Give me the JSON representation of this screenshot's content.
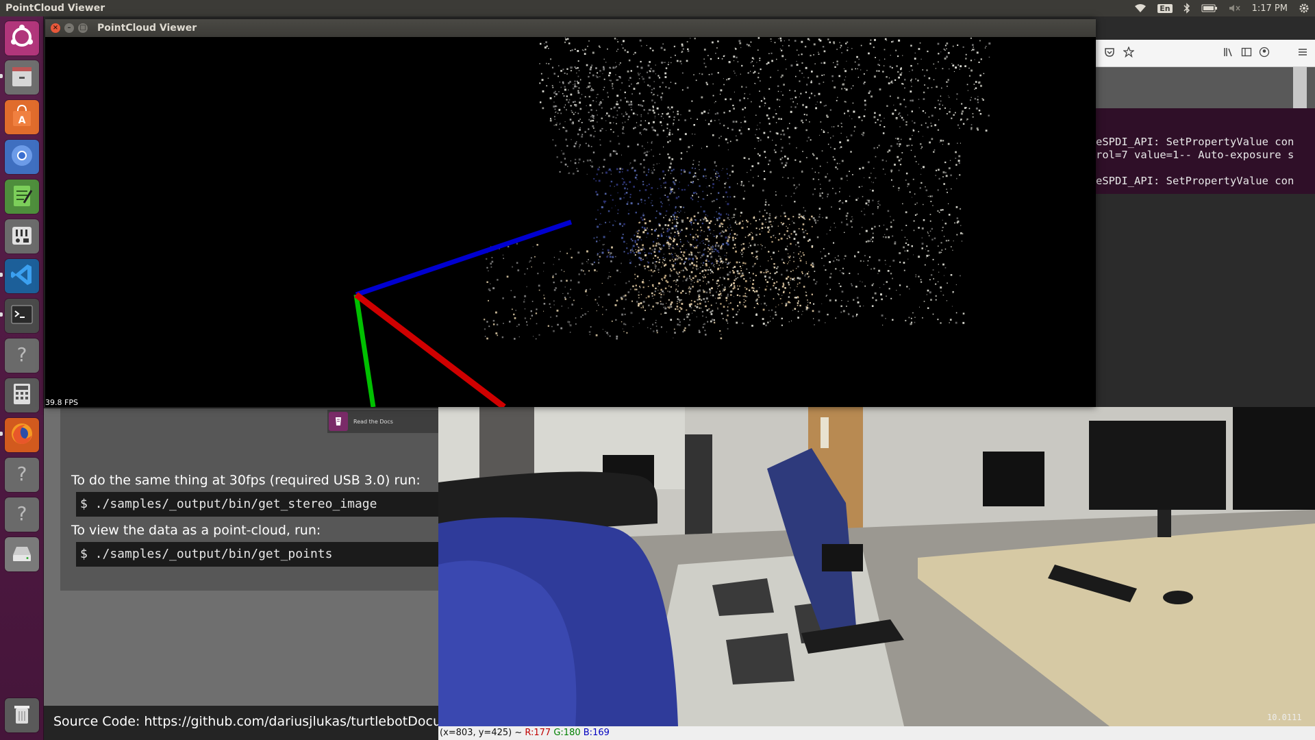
{
  "top_panel": {
    "app_title": "PointCloud Viewer",
    "keyboard_layout": "En",
    "clock": "1:17 PM"
  },
  "launcher": {
    "items": [
      {
        "name": "ubuntu-dash",
        "icon": "ubuntu-logo-icon"
      },
      {
        "name": "files",
        "icon": "file-cabinet-icon"
      },
      {
        "name": "software-center",
        "icon": "shopping-bag-icon"
      },
      {
        "name": "chromium",
        "icon": "chromium-icon"
      },
      {
        "name": "text-editor",
        "icon": "notepad-icon"
      },
      {
        "name": "system-settings",
        "icon": "mixer-icon"
      },
      {
        "name": "vscode",
        "icon": "vscode-icon"
      },
      {
        "name": "terminal",
        "icon": "terminal-icon"
      },
      {
        "name": "unknown-app-1",
        "icon": "question-icon"
      },
      {
        "name": "calculator",
        "icon": "calculator-icon"
      },
      {
        "name": "firefox",
        "icon": "firefox-icon"
      },
      {
        "name": "unknown-app-2",
        "icon": "question-icon"
      },
      {
        "name": "unknown-app-3",
        "icon": "question-icon"
      },
      {
        "name": "disk",
        "icon": "drive-icon"
      },
      {
        "name": "trash",
        "icon": "trash-icon"
      }
    ]
  },
  "pointcloud_window": {
    "title": "PointCloud Viewer",
    "fps": "39.8 FPS",
    "axis_colors": {
      "x": "#d00000",
      "y": "#00c000",
      "z": "#0000d0"
    }
  },
  "terminal": {
    "lines": [
      "eSPDI_API: SetPropertyValue con",
      "rol=7 value=1-- Auto-exposure s",
      "",
      "eSPDI_API: SetPropertyValue con"
    ]
  },
  "docs": {
    "rtd_badge": "Read the Docs",
    "line_30fps": "To do the same thing at 30fps (required USB 3.0) run:",
    "cmd_stereo": "$ ./samples/_output/bin/get_stereo_image",
    "line_pointcloud": "To view the data as a point-cloud, run:",
    "cmd_points": "$ ./samples/_output/bin/get_points",
    "source_code": "Source Code: https://github.com/dariusjlukas/turtlebotDocumen"
  },
  "camera_view": {
    "status_coords": "(x=803, y=425) ~ ",
    "r_value": "R:177",
    "g_value": "G:180",
    "b_value": "B:169",
    "overlay_value": "10.0111"
  }
}
